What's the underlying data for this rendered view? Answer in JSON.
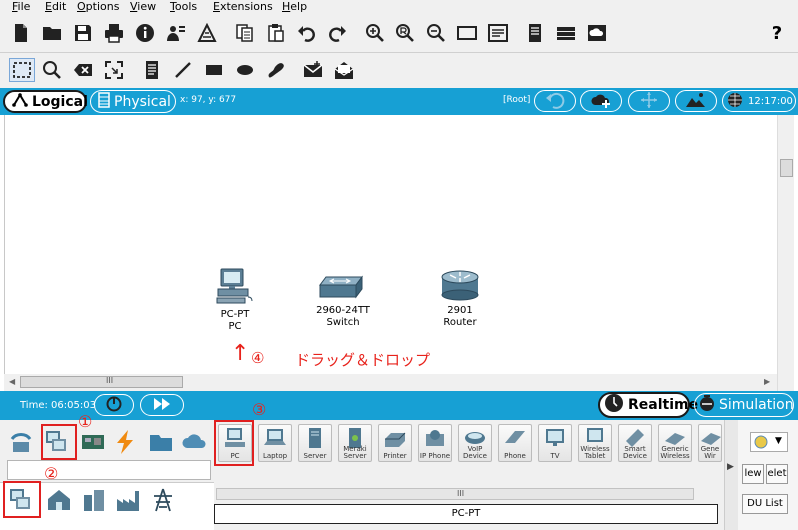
{
  "menu": [
    "File",
    "Edit",
    "Options",
    "View",
    "Tools",
    "Extensions",
    "Help"
  ],
  "toolbar": {
    "help_symbol": "?"
  },
  "topbar": {
    "logical_label": "Logical",
    "physical_label": "Physical",
    "coords": "x: 97, y: 677",
    "root_label": "[Root]",
    "clock": "12:17:00"
  },
  "devices": [
    {
      "model": "PC-PT",
      "name": "PC"
    },
    {
      "model": "2960-24TT",
      "name": "Switch"
    },
    {
      "model": "2901",
      "name": "Router"
    }
  ],
  "annotations": {
    "mark1": "①",
    "mark2": "②",
    "mark3": "③",
    "mark4": "④",
    "drag_text": "ドラッグ＆ドロップ",
    "arrow": "↑"
  },
  "bottombar": {
    "time_label": "Time: 06:05:03",
    "realtime_label": "Realtime",
    "simulation_label": "Simulation"
  },
  "device_list": [
    "PC",
    "Laptop",
    "Server",
    "Meraki Server",
    "Printer",
    "IP Phone",
    "VoIP Device",
    "Phone",
    "TV",
    "Wireless Tablet",
    "Smart Device",
    "Generic Wireless",
    "Gene Wir"
  ],
  "selected_device_label": "PC-PT",
  "scroll_grip": "III",
  "right_panel": {
    "new_label": "lew",
    "delete_label": "elet",
    "pdu_label": "DU List"
  },
  "colors": {
    "accent_blue": "#17a0d4",
    "annotation_red": "#e02020"
  }
}
